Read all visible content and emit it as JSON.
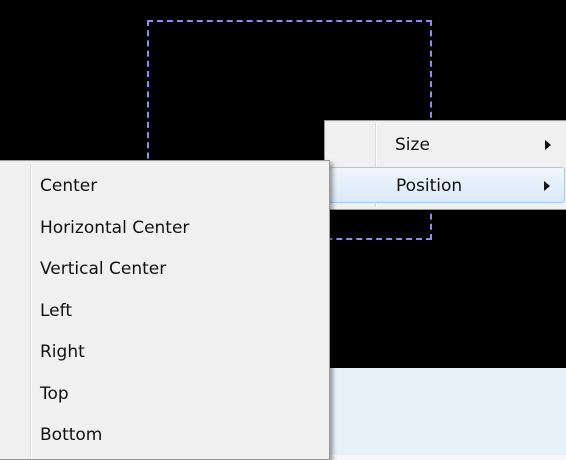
{
  "parent_menu": {
    "items": [
      {
        "label": "Size",
        "has_submenu": true,
        "icon": "chevron-right-icon"
      },
      {
        "label": "Position",
        "has_submenu": true,
        "icon": "chevron-right-icon",
        "highlighted": true
      }
    ]
  },
  "position_submenu": {
    "items": [
      {
        "label": "Center"
      },
      {
        "label": "Horizontal Center"
      },
      {
        "label": "Vertical Center"
      },
      {
        "label": "Left"
      },
      {
        "label": "Right"
      },
      {
        "label": "Top"
      },
      {
        "label": "Bottom"
      }
    ]
  },
  "colors": {
    "canvas": "#000000",
    "selection_border": "#8d8cf0",
    "menu_background": "#f0f0f0",
    "highlight": "#dbe9f7"
  }
}
